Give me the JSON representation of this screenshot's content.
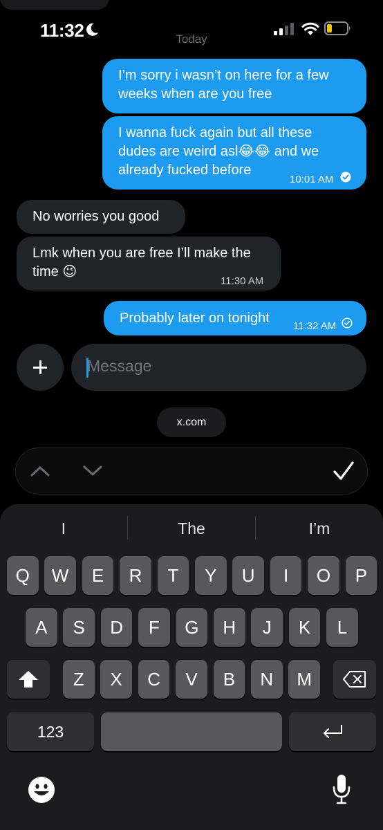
{
  "status_bar": {
    "time": "11:32",
    "icons": [
      "moon-icon",
      "cellular-signal-icon",
      "wifi-icon",
      "battery-low-icon"
    ],
    "battery_color": "#f5c400"
  },
  "conversation": {
    "date_divider": "Today",
    "messages": [
      {
        "direction": "outgoing",
        "text": "I’m sorry i wasn’t on here for a few weeks when are you free",
        "time": ""
      },
      {
        "direction": "outgoing",
        "text": "I wanna fuck again but all these dudes are weird asl😂😂 and we already fucked before",
        "time": "10:01 AM",
        "status": "read"
      },
      {
        "direction": "incoming",
        "text": "No worries you good",
        "time": ""
      },
      {
        "direction": "incoming",
        "text": "Lmk when you are free I’ll make the time 😉",
        "time": "11:30 AM"
      },
      {
        "direction": "outgoing",
        "text": "Probably later on tonight",
        "time": "11:32 AM",
        "status": "sent"
      }
    ]
  },
  "composer": {
    "placeholder": "Message",
    "add_icon": "plus-icon"
  },
  "browser": {
    "url": "x.com"
  },
  "form_nav": {
    "icons": [
      "chevron-up-icon",
      "chevron-down-icon",
      "checkmark-icon"
    ]
  },
  "keyboard": {
    "suggestions": [
      "I",
      "The",
      "I’m"
    ],
    "row1": [
      "Q",
      "W",
      "E",
      "R",
      "T",
      "Y",
      "U",
      "I",
      "O",
      "P"
    ],
    "row2": [
      "A",
      "S",
      "D",
      "F",
      "G",
      "H",
      "J",
      "K",
      "L"
    ],
    "row3": [
      "Z",
      "X",
      "C",
      "V",
      "B",
      "N",
      "M"
    ],
    "numbers_label": "123",
    "icons": [
      "shift-icon",
      "backspace-icon",
      "return-icon",
      "emoji-icon",
      "microphone-icon"
    ]
  },
  "colors": {
    "accent": "#1d9bf0",
    "incoming_bubble": "#202327",
    "background": "#000000"
  }
}
